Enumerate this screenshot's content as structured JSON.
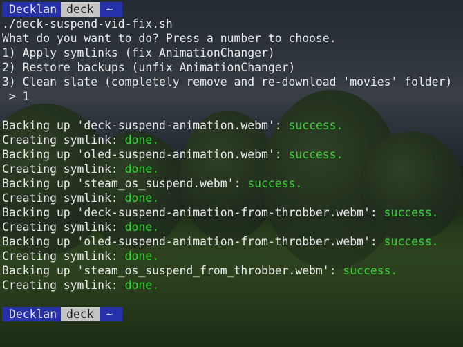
{
  "prompt_top": {
    "user": "Decklan",
    "host": "deck",
    "dir": "~"
  },
  "command": "./deck-suspend-vid-fix.sh",
  "menu": {
    "question": "What do you want to do? Press a number to choose.",
    "options": [
      "1) Apply symlinks (fix AnimationChanger)",
      "2) Restore backups (unfix AnimationChanger)",
      "3) Clean slate (completely remove and re-download 'movies' folder)"
    ],
    "input_line": " > 1"
  },
  "log": [
    {
      "text": "Backing up 'deck-suspend-animation.webm': ",
      "status": "success."
    },
    {
      "text": "Creating symlink: ",
      "status": "done."
    },
    {
      "text": "Backing up 'oled-suspend-animation.webm': ",
      "status": "success."
    },
    {
      "text": "Creating symlink: ",
      "status": "done."
    },
    {
      "text": "Backing up 'steam_os_suspend.webm': ",
      "status": "success."
    },
    {
      "text": "Creating symlink: ",
      "status": "done."
    },
    {
      "text": "Backing up 'deck-suspend-animation-from-throbber.webm': ",
      "status": "success."
    },
    {
      "text": "Creating symlink: ",
      "status": "done."
    },
    {
      "text": "Backing up 'oled-suspend-animation-from-throbber.webm': ",
      "status": "success."
    },
    {
      "text": "Creating symlink: ",
      "status": "done."
    },
    {
      "text": "Backing up 'steam_os_suspend_from_throbber.webm': ",
      "status": "success."
    },
    {
      "text": "Creating symlink: ",
      "status": "done."
    }
  ],
  "prompt_bottom": {
    "user": "Decklan",
    "host": "deck",
    "dir": "~"
  },
  "colors": {
    "success": "#37d437",
    "prompt_blue": "#2630a8",
    "prompt_gray": "#c5c5c5"
  }
}
